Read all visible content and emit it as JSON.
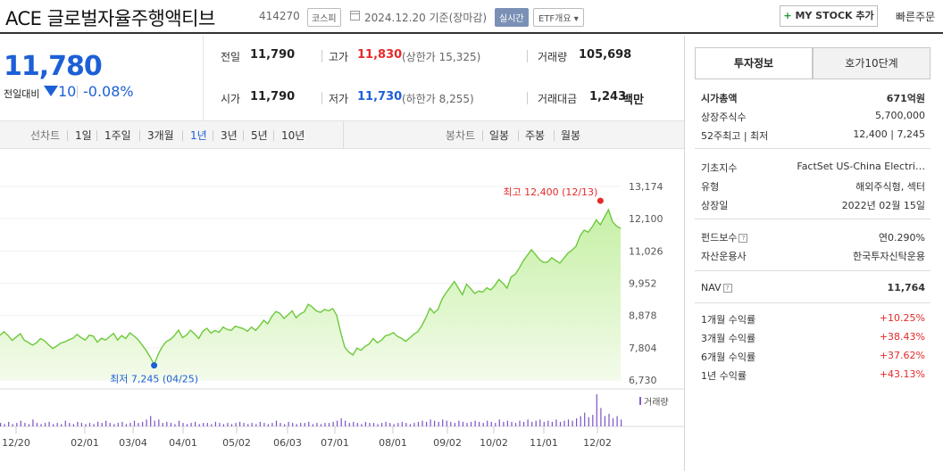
{
  "header": {
    "stock_name": "ACE 글로벌자율주행액티브",
    "stock_code": "414270",
    "market": "코스피",
    "date_text": "2024.12.20 기준(장마감)",
    "realtime": "실시간",
    "etf_overview": "ETF개요 ▾",
    "my_stock": "MY STOCK 추가",
    "my_stock_plus": "+",
    "quick_order": "빠른주문"
  },
  "price": {
    "current": "11,780",
    "change_label": "전일대비",
    "change": "10",
    "change_rate": "-0.08%",
    "direction": "down",
    "color": "#1d5fd6"
  },
  "stats": {
    "prev_label": "전일",
    "prev_value": "11,790",
    "high_label": "고가",
    "high_value": "11,830",
    "upper_limit": "(상한가 15,325)",
    "volume_label": "거래량",
    "volume_value": "105,698",
    "open_label": "시가",
    "open_value": "11,790",
    "low_label": "저가",
    "low_value": "11,730",
    "lower_limit": "(하한가 8,255)",
    "amount_label": "거래대금",
    "amount_value": "1,243",
    "amount_unit": "백만"
  },
  "range_bar": {
    "line_chart": "선차트",
    "ranges": [
      "1일",
      "1주일",
      "3개월",
      "1년",
      "3년",
      "5년",
      "10년"
    ],
    "active_range": "1년",
    "candle_chart": "봉차트",
    "candles": [
      "일봉",
      "주봉",
      "월봉"
    ]
  },
  "chart_data": {
    "type": "area",
    "y_ticks": [
      "13,174",
      "12,100",
      "11,026",
      "9,952",
      "8,878",
      "7,804",
      "6,730"
    ],
    "ylim": [
      6730,
      13174
    ],
    "x_ticks": [
      "12/20",
      "02/01",
      "03/04",
      "04/01",
      "05/02",
      "06/03",
      "07/01",
      "08/01",
      "09/02",
      "10/02",
      "11/01",
      "12/02"
    ],
    "values": [
      8220,
      8340,
      8210,
      8050,
      8160,
      8270,
      8050,
      7980,
      7890,
      7970,
      8110,
      8030,
      7900,
      7780,
      7860,
      7960,
      8000,
      8070,
      8120,
      8250,
      8140,
      8060,
      8220,
      8190,
      7990,
      8120,
      8060,
      8170,
      8280,
      8060,
      8210,
      8110,
      8300,
      8200,
      8080,
      7900,
      7720,
      7500,
      7245,
      7590,
      7840,
      8010,
      8080,
      8210,
      8390,
      8140,
      8230,
      8390,
      8260,
      8110,
      8350,
      8450,
      8290,
      8380,
      8320,
      8490,
      8410,
      8380,
      8520,
      8480,
      8440,
      8350,
      8490,
      8380,
      8530,
      8720,
      8600,
      8840,
      9010,
      8950,
      8780,
      8900,
      9030,
      8800,
      8930,
      9000,
      9250,
      9160,
      9030,
      8980,
      9080,
      9030,
      9110,
      8890,
      8310,
      7820,
      7660,
      7560,
      7790,
      7720,
      7850,
      7930,
      8110,
      7970,
      8050,
      8200,
      8240,
      8310,
      8180,
      8120,
      8020,
      8130,
      8250,
      8340,
      8540,
      8810,
      9120,
      8960,
      9090,
      9430,
      9640,
      9820,
      10010,
      9790,
      9570,
      9920,
      9780,
      9610,
      9690,
      9660,
      9800,
      9730,
      9880,
      10080,
      9950,
      9790,
      10160,
      10250,
      10450,
      10700,
      10880,
      11070,
      10910,
      10740,
      10640,
      10660,
      10800,
      10710,
      10620,
      10780,
      10950,
      11050,
      11180,
      11530,
      11720,
      11650,
      11830,
      12060,
      11900,
      12150,
      12400,
      12000,
      11850,
      11780
    ],
    "high_label": "최고 12,400 (12/13)",
    "low_label": "최저 7,245 (04/25)",
    "high_color": "#e52a2a",
    "low_color": "#1d5fd6",
    "line_color": "#6cc93b",
    "volume_label": "거래량",
    "volume": [
      3,
      2,
      4,
      2,
      3,
      5,
      3,
      2,
      6,
      3,
      2,
      3,
      4,
      2,
      3,
      2,
      5,
      3,
      2,
      4,
      3,
      2,
      3,
      2,
      4,
      3,
      5,
      3,
      2,
      3,
      4,
      2,
      3,
      5,
      3,
      4,
      6,
      9,
      5,
      6,
      3,
      4,
      3,
      2,
      5,
      3,
      2,
      3,
      4,
      2,
      3,
      3,
      2,
      4,
      3,
      2,
      3,
      2,
      3,
      4,
      3,
      2,
      3,
      2,
      4,
      3,
      2,
      3,
      5,
      3,
      2,
      4,
      3,
      2,
      3,
      3,
      4,
      2,
      3,
      2,
      3,
      3,
      4,
      5,
      7,
      5,
      3,
      4,
      3,
      2,
      4,
      3,
      3,
      2,
      3,
      4,
      3,
      2,
      3,
      4,
      3,
      2,
      3,
      4,
      5,
      4,
      6,
      5,
      4,
      6,
      5,
      4,
      3,
      5,
      4,
      3,
      4,
      5,
      4,
      3,
      5,
      4,
      3,
      6,
      4,
      5,
      4,
      3,
      5,
      4,
      6,
      4,
      5,
      6,
      4,
      5,
      4,
      6,
      4,
      5,
      6,
      5,
      7,
      9,
      12,
      8,
      10,
      28,
      16,
      9,
      11,
      7,
      9,
      6
    ]
  },
  "side": {
    "tab_invest": "투자정보",
    "tab_quote": "호가10단계",
    "rows_a": [
      {
        "label": "시가총액",
        "value": "671억원"
      },
      {
        "label": "상장주식수",
        "value": "5,700,000"
      },
      {
        "label": "52주최고 | 최저",
        "value": "12,400 | 7,245"
      }
    ],
    "rows_b": [
      {
        "label": "기초지수",
        "value": "FactSet US-China Electri…"
      },
      {
        "label": "유형",
        "value": "해외주식형, 섹터"
      },
      {
        "label": "상장일",
        "value": "2022년 02월 15일"
      }
    ],
    "rows_c": [
      {
        "label": "펀드보수",
        "value": "연0.290%"
      },
      {
        "label": "자산운용사",
        "value": "한국투자신탁운용"
      }
    ],
    "nav_label": "NAV",
    "nav_value": "11,764",
    "help_glyph": "?",
    "returns": [
      {
        "label": "1개월 수익률",
        "value": "+10.25%"
      },
      {
        "label": "3개월 수익률",
        "value": "+38.43%"
      },
      {
        "label": "6개월 수익률",
        "value": "+37.62%"
      },
      {
        "label": "1년 수익률",
        "value": "+43.13%"
      }
    ]
  }
}
